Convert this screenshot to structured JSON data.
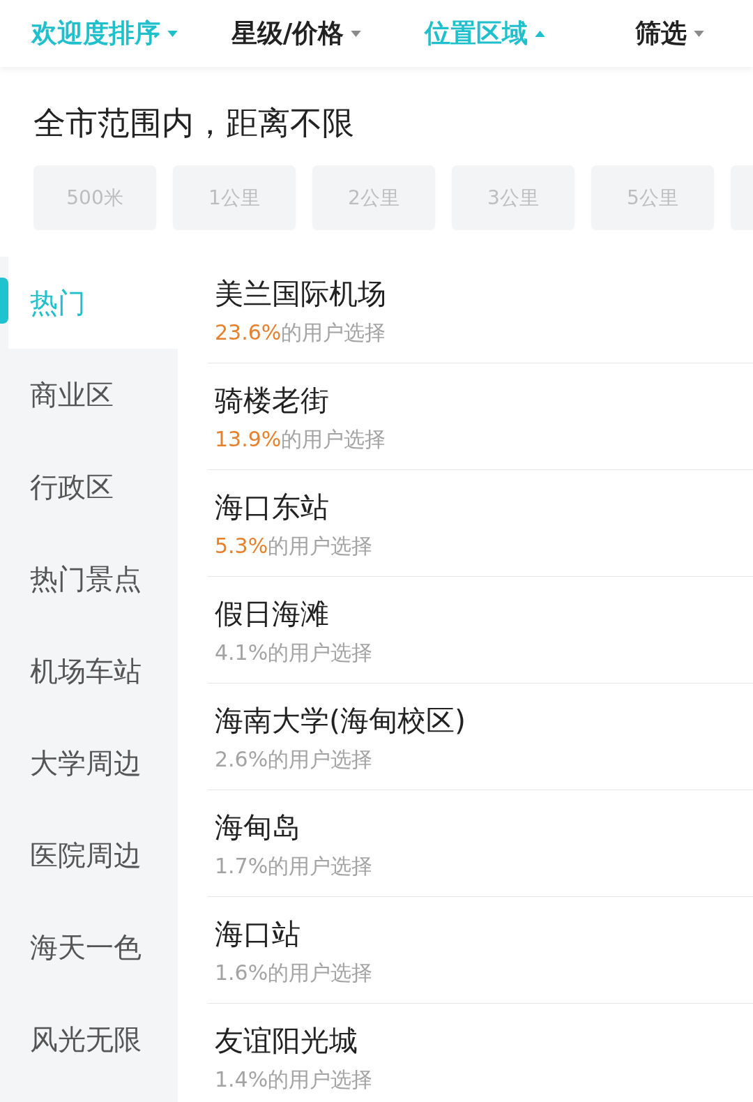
{
  "tabs": [
    {
      "label": "欢迎度排序",
      "active": true,
      "expanded": false
    },
    {
      "label": "星级/价格",
      "active": false,
      "expanded": false
    },
    {
      "label": "位置区域",
      "active": true,
      "expanded": true
    },
    {
      "label": "筛选",
      "active": false,
      "expanded": false
    }
  ],
  "scope_title": "全市范围内，距离不限",
  "distance_chips": [
    "500米",
    "1公里",
    "2公里",
    "3公里",
    "5公里"
  ],
  "sidebar": {
    "items": [
      {
        "label": "热门",
        "selected": true
      },
      {
        "label": "商业区",
        "selected": false
      },
      {
        "label": "行政区",
        "selected": false
      },
      {
        "label": "热门景点",
        "selected": false
      },
      {
        "label": "机场车站",
        "selected": false
      },
      {
        "label": "大学周边",
        "selected": false
      },
      {
        "label": "医院周边",
        "selected": false
      },
      {
        "label": "海天一色",
        "selected": false
      },
      {
        "label": "风光无限",
        "selected": false
      }
    ]
  },
  "locations": [
    {
      "name": "美兰国际机场",
      "share": "23.6%",
      "share_label": "的用户选择",
      "highlighted": true
    },
    {
      "name": "骑楼老街",
      "share": "13.9%",
      "share_label": "的用户选择",
      "highlighted": true
    },
    {
      "name": "海口东站",
      "share": "5.3%",
      "share_label": "的用户选择",
      "highlighted": true
    },
    {
      "name": "假日海滩",
      "share": "4.1%",
      "share_label": "的用户选择",
      "highlighted": false
    },
    {
      "name": "海南大学(海甸校区)",
      "share": "2.6%",
      "share_label": "的用户选择",
      "highlighted": false
    },
    {
      "name": "海甸岛",
      "share": "1.7%",
      "share_label": "的用户选择",
      "highlighted": false
    },
    {
      "name": "海口站",
      "share": "1.6%",
      "share_label": "的用户选择",
      "highlighted": false
    },
    {
      "name": "友谊阳光城",
      "share": "1.4%",
      "share_label": "的用户选择",
      "highlighted": false
    }
  ]
}
